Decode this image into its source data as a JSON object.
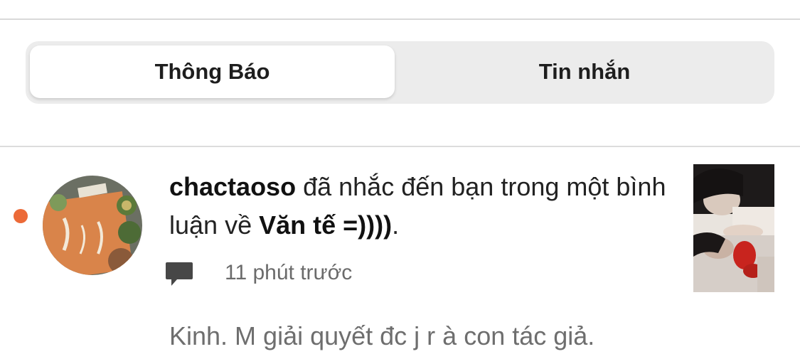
{
  "tabs": [
    {
      "label": "Thông Báo",
      "active": true
    },
    {
      "label": "Tin nhắn",
      "active": false
    }
  ],
  "notification": {
    "username": "chactaoso",
    "action_text": " đã nhắc đến bạn trong một bình luận về ",
    "story_title": "Văn tế =))))",
    "end_punct": ".",
    "timestamp": "11 phút trước",
    "comment_preview": "Kinh. M giải quyết đc j r à con tác giả.",
    "unread": true,
    "comment_icon": "speech-bubble-icon"
  },
  "colors": {
    "unread_dot": "#ec6a38",
    "tab_bg": "#ececec",
    "tab_active_bg": "#ffffff",
    "muted_text": "#6b6b6b"
  }
}
